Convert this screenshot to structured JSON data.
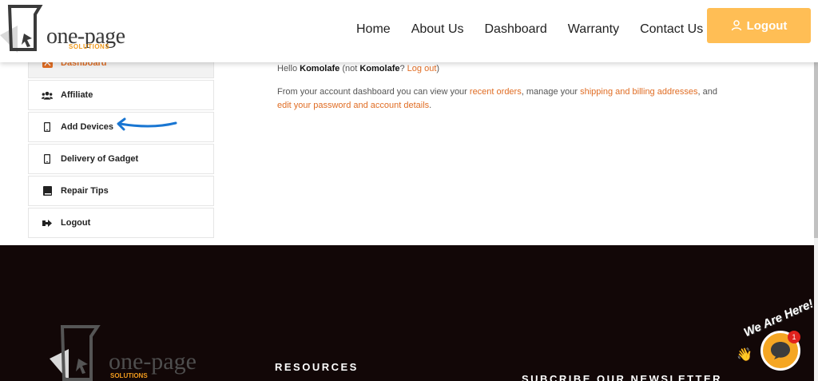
{
  "brand": {
    "name": "one-page",
    "sub": "SOLUTIONS"
  },
  "nav": {
    "items": [
      "Home",
      "About Us",
      "Dashboard",
      "Warranty",
      "Contact Us"
    ],
    "logout_label": "Logout"
  },
  "sidebar": {
    "items": [
      {
        "label": "Dashboard",
        "icon": "dashboard-icon"
      },
      {
        "label": "Affiliate",
        "icon": "users-icon"
      },
      {
        "label": "Add Devices",
        "icon": "mobile-icon"
      },
      {
        "label": "Delivery of Gadget",
        "icon": "mobile-icon"
      },
      {
        "label": "Repair Tips",
        "icon": "book-icon"
      },
      {
        "label": "Logout",
        "icon": "sign-out-icon"
      }
    ]
  },
  "account": {
    "hello": "Hello",
    "user": "Komolafe",
    "not_prefix": "(not",
    "not_user": "Komolafe",
    "question": "?",
    "logout_link": "Log out",
    "close_paren": ")",
    "intro": "From your account dashboard you can view your",
    "recent_orders": "recent orders",
    "manage": ", manage your",
    "addresses": "shipping and billing addresses",
    "and": ", and",
    "edit": "edit your password and account details",
    "period": "."
  },
  "footer": {
    "resources": "RESOURCES",
    "newsletter": "SUBCRIBE OUR NEWSLETTER"
  },
  "chat": {
    "label": "We Are Here!",
    "badge": "1"
  },
  "colors": {
    "accent": "#e06d24",
    "button": "#ffbe55",
    "footer_bg": "#120707",
    "annotation": "#1976d2"
  }
}
